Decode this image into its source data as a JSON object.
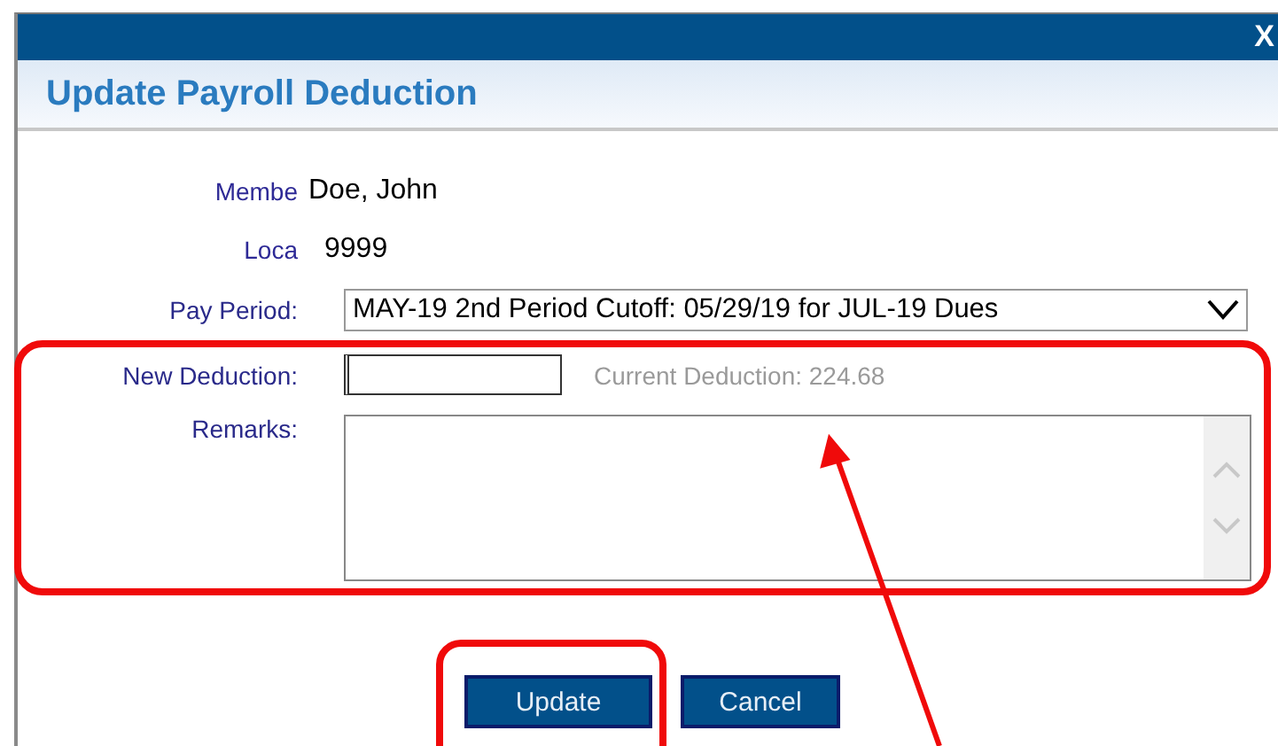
{
  "window": {
    "close": "X",
    "title": "Update Payroll Deduction"
  },
  "fields": [
    {
      "kind": "text",
      "label": "Membe",
      "value": "Doe, John"
    },
    {
      "kind": "text",
      "label": "Loca",
      "value": "9999"
    },
    {
      "kind": "select",
      "label": "Pay Period:",
      "value": "MAY-19 2nd Period Cutoff: 05/29/19 for JUL-19 Dues"
    },
    {
      "kind": "input",
      "label": "New Deduction:",
      "note": "Current Deduction: 224.68"
    },
    {
      "kind": "textarea",
      "label": "Remarks:"
    }
  ],
  "buttons": [
    "Update",
    "Cancel"
  ]
}
